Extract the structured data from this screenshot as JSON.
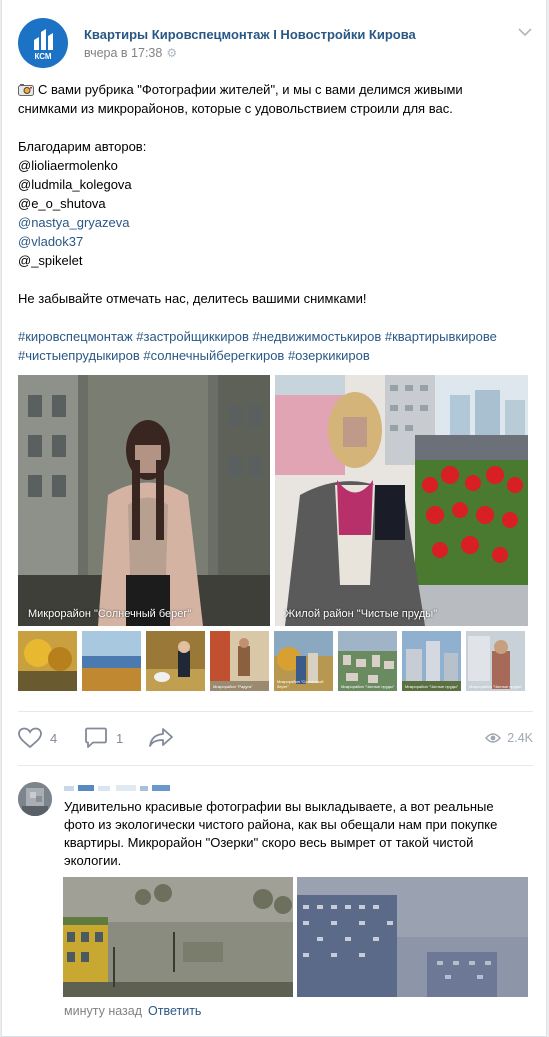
{
  "post": {
    "group_name": "Квартиры Кировспецмонтаж I Новостройки Кирова",
    "time": "вчера в 17:38",
    "avatar_logo_text": "КСМ",
    "text_line_1": "С вами рубрика \"Фотографии жителей\", и мы с вами делимся живыми",
    "text_line_2": "снимками из микрорайонов, которые с удовольствием строили для вас.",
    "thanks": "Благодарим авторов:",
    "mentions": [
      "@lioliaermolenko",
      "@ludmila_kolegova",
      "@e_o_shutova",
      "@nastya_gryazeva",
      "@vladok37",
      "@_spikelet"
    ],
    "reminder": "Не забывайте отмечать нас, делитесь вашими снимками!",
    "hashtags_line_1": "#кировспецмонтаж #застройщиккиров #недвижимостькиров #квартирывкирове",
    "hashtags_line_2": "#чистыепрудыкиров #солнечныйберегкиров #озеркикиров",
    "photo_captions": [
      "Микрорайон \"Солнечный берег\"",
      "Жилой район \"Чистые пруды\""
    ],
    "thumb_captions": [
      "",
      "",
      "",
      "Микрорайон \"Радуга\"",
      "Микрорайон \"Солнечный берег\"",
      "Микрорайон \"Чистые пруды\"",
      "Микрорайон \"Чистые пруды\"",
      "Микрорайон \"Чистые пруды\""
    ]
  },
  "actions": {
    "likes": "4",
    "comments": "1",
    "views": "2.4K"
  },
  "comment": {
    "text_lines": [
      "Удивительно красивые фотографии вы выкладываете, а вот реальные",
      "фото из экологически чистого района, как вы обещали нам при покупке",
      "квартиры. Микрорайон \"Озерки\" скоро весь вымрет от такой чистой",
      "экологии."
    ],
    "time": "минуту назад",
    "reply_label": "Ответить"
  },
  "colors": {
    "link": "#2a5885",
    "meta": "#828282",
    "brand": "#1c72c5"
  }
}
